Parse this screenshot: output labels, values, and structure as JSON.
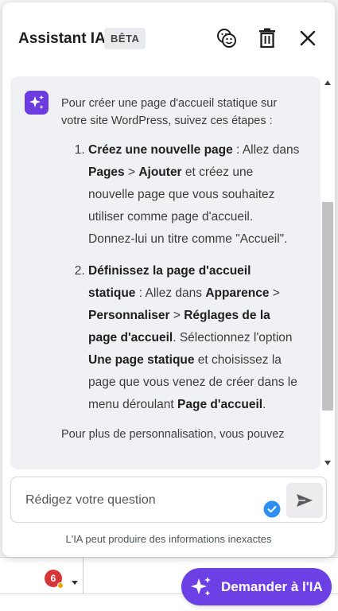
{
  "header": {
    "title": "Assistant IA",
    "badge": "BÊTA",
    "icons": [
      "emoji-icon",
      "trash-icon",
      "close-icon"
    ]
  },
  "message": {
    "intro": "Pour créer une page d'accueil statique sur votre site WordPress, suivez ces étapes :",
    "steps": [
      {
        "b1": "Créez une nouvelle page",
        "t1": " : Allez dans ",
        "b2": "Pages",
        "t2": " > ",
        "b3": "Ajouter",
        "t3": " et créez une nouvelle page que vous souhaitez utiliser comme page d'accueil. Donnez-lui un titre comme \"Accueil\"."
      },
      {
        "b1": "Définissez la page d'accueil statique",
        "t1": " : Allez dans ",
        "b2": "Apparence",
        "t2": " > ",
        "b3": "Personnaliser",
        "t3": " > ",
        "b4": "Réglages de la page d'accueil",
        "t4": ". Sélectionnez l'option ",
        "b5": "Une page statique",
        "t5": " et choisissez la page que vous venez de créer dans le menu déroulant ",
        "b6": "Page d'accueil",
        "t6": "."
      }
    ],
    "after": "Pour plus de personnalisation, vous pouvez"
  },
  "input": {
    "placeholder": "Rédigez votre question"
  },
  "disclaimer": "L'IA peut produire des informations inexactes",
  "ask_button": "Demander à l'IA",
  "notification_count": "6",
  "colors": {
    "accent": "#6c40e4",
    "chat_bg": "#f0f1f4",
    "check": "#2d8ff0",
    "badge": "#d63638"
  }
}
